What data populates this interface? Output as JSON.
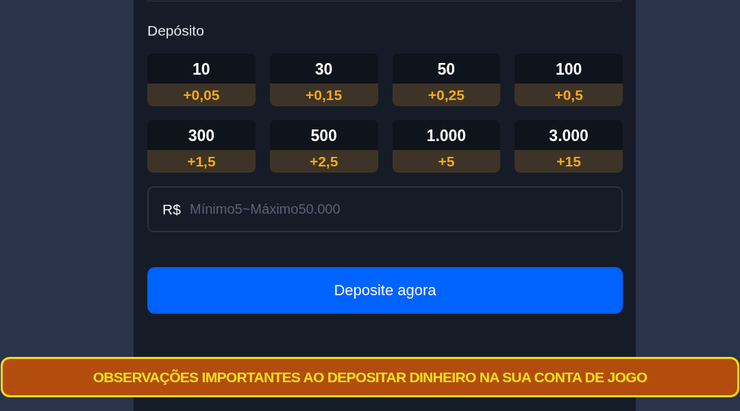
{
  "deposit": {
    "label": "Depósito",
    "options": [
      {
        "amount": "10",
        "bonus": "+0,05"
      },
      {
        "amount": "30",
        "bonus": "+0,15"
      },
      {
        "amount": "50",
        "bonus": "+0,25"
      },
      {
        "amount": "100",
        "bonus": "+0,5"
      },
      {
        "amount": "300",
        "bonus": "+1,5"
      },
      {
        "amount": "500",
        "bonus": "+2,5"
      },
      {
        "amount": "1.000",
        "bonus": "+5"
      },
      {
        "amount": "3.000",
        "bonus": "+15"
      }
    ],
    "amount_field": {
      "currency": "R$",
      "placeholder": "Mínimo5~Máximo50.000"
    },
    "submit_button": "Deposite agora"
  },
  "caption_banner": "OBSERVAÇÕES IMPORTANTES AO DEPOSITAR DINHEIRO NA SUA CONTA DE JOGO"
}
